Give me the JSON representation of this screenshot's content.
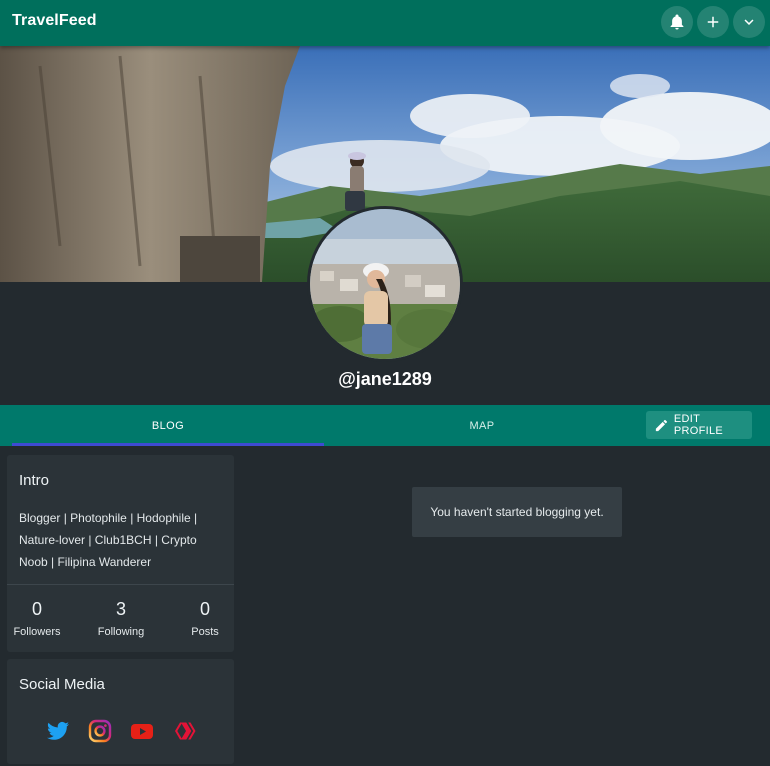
{
  "app": {
    "brand": "TravelFeed"
  },
  "topbar": {
    "icons": [
      "bell-icon",
      "plus-icon",
      "chevron-down-icon"
    ]
  },
  "profile": {
    "username": "@jane1289"
  },
  "tabs": {
    "blog": "BLOG",
    "map": "MAP",
    "edit_profile": "EDIT PROFILE"
  },
  "intro": {
    "title": "Intro",
    "bio": "Blogger | Photophile | Hodophile | Nature-lover | Club1BCH | Crypto Noob | Filipina Wanderer",
    "stats": {
      "followers_count": "0",
      "followers_label": "Followers",
      "following_count": "3",
      "following_label": "Following",
      "posts_count": "0",
      "posts_label": "Posts"
    }
  },
  "social": {
    "title": "Social Media",
    "icons": [
      "twitter-icon",
      "instagram-icon",
      "youtube-icon",
      "hive-icon"
    ]
  },
  "feed": {
    "empty_message": "You haven't started blogging yet."
  },
  "colors": {
    "topbar": "#006f5c",
    "tabs": "#00796b",
    "background": "#232a2f",
    "card": "#2b3338",
    "tab_indicator": "#3e4bd2",
    "twitter": "#1da1f2",
    "youtube": "#e62117",
    "hive": "#e31337"
  }
}
